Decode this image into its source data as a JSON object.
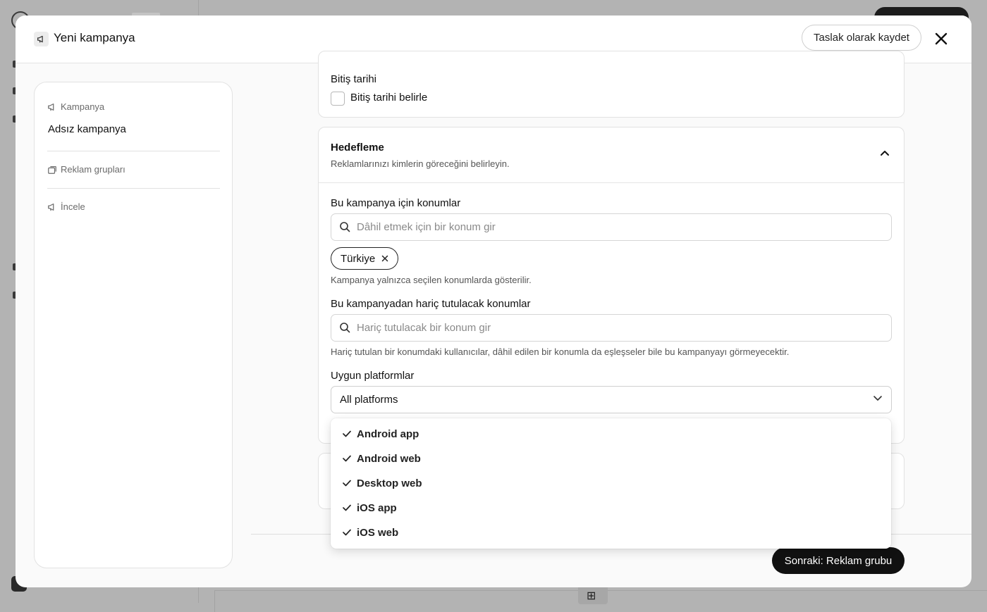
{
  "modal": {
    "title": "Yeni kampanya",
    "draft_label": "Taslak olarak kaydet"
  },
  "steps": {
    "campaign_title": "Kampanya",
    "campaign_value": "Adsız kampanya",
    "ad_groups_title": "Reklam grupları",
    "review_title": "İncele"
  },
  "end_date": {
    "label": "Bitiş tarihi",
    "checkbox_label": "Bitiş tarihi belirle",
    "checked": false
  },
  "targeting": {
    "title": "Hedefleme",
    "subtitle": "Reklamlarınızı kimlerin göreceğini belirleyin.",
    "include_label": "Bu kampanya için konumlar",
    "include_placeholder": "Dâhil etmek için bir konum gir",
    "selected_location": "Türkiye",
    "include_help": "Kampanya yalnızca seçilen konumlarda gösterilir.",
    "exclude_label": "Bu kampanyadan hariç tutulacak konumlar",
    "exclude_placeholder": "Hariç tutulacak bir konum gir",
    "exclude_help": "Hariç tutulan bir konumdaki kullanıcılar, dâhil edilen bir konumla da eşleşseler bile bu kampanyayı görmeyecektir.",
    "platforms_label": "Uygun platformlar",
    "platforms_value": "All platforms"
  },
  "platform_options": [
    {
      "label": "Android app",
      "checked": true
    },
    {
      "label": "Android web",
      "checked": true
    },
    {
      "label": "Desktop web",
      "checked": true
    },
    {
      "label": "iOS app",
      "checked": true
    },
    {
      "label": "iOS web",
      "checked": true
    }
  ],
  "footer": {
    "next_label": "Sonraki: Reklam grubu"
  },
  "icons": {
    "modal": "megaphone-icon",
    "close": "close-icon",
    "campaign": "megaphone-icon",
    "ad_groups": "stacked-cards-icon",
    "review": "megaphone-icon",
    "search": "search-icon",
    "chevron_up": "chevron-up-icon",
    "chevron_down": "chevron-down-icon",
    "remove_tag": "close-icon",
    "check": "check-icon"
  },
  "colors": {
    "primary": "#111111",
    "overlay": "#b3b3b3",
    "border": "#e2e2e2"
  }
}
